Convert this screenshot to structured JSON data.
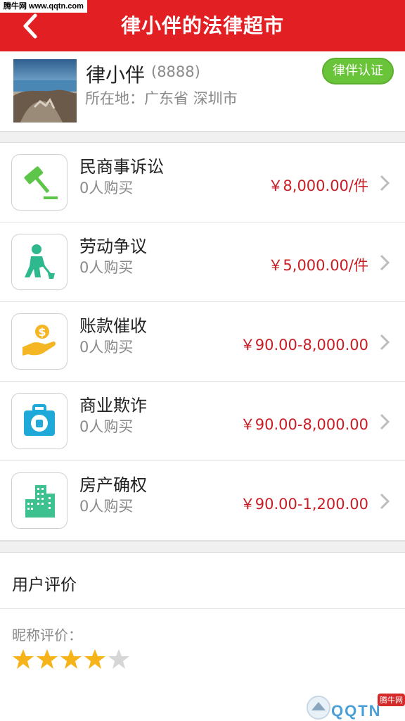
{
  "watermark_top": "腾牛网 www.qqtn.com",
  "header": {
    "title": "律小伴的法律超市"
  },
  "profile": {
    "name": "律小伴",
    "id": "(8888)",
    "location": "所在地：广东省 深圳市",
    "badge": "律伴认证"
  },
  "services": [
    {
      "name": "民商事诉讼",
      "count": "0人购买",
      "price": "￥8,000.00/件",
      "icon": "gavel-icon",
      "color": "#5dc54a"
    },
    {
      "name": "劳动争议",
      "count": "0人购买",
      "price": "￥5,000.00/件",
      "icon": "worker-shovel-icon",
      "color": "#2db88e"
    },
    {
      "name": "账款催收",
      "count": "0人购买",
      "price": "￥90.00-8,000.00",
      "icon": "hand-money-icon",
      "color": "#f5b623"
    },
    {
      "name": "商业欺诈",
      "count": "0人购买",
      "price": "￥90.00-8,000.00",
      "icon": "briefcase-stop-icon",
      "color": "#1fa9d9"
    },
    {
      "name": "房产确权",
      "count": "0人购买",
      "price": "￥90.00-1,200.00",
      "icon": "buildings-icon",
      "color": "#3cc18f"
    }
  ],
  "reviews": {
    "title": "用户评价",
    "nickname_label": "昵称评价：",
    "rating": 4,
    "rating_max": 5
  },
  "watermark_br": {
    "text": "QQTN",
    "badge": "腾牛网"
  }
}
